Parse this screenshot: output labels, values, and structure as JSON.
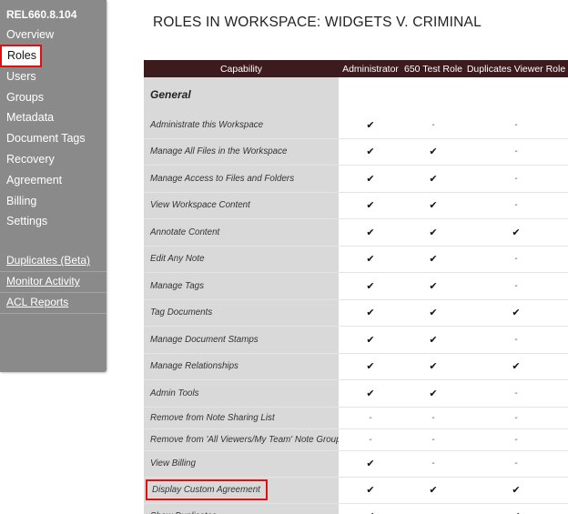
{
  "sidebar": {
    "version": "REL660.8.104",
    "nav": [
      "Overview",
      "Roles",
      "Users",
      "Groups",
      "Metadata",
      "Document Tags",
      "Recovery",
      "Agreement",
      "Billing",
      "Settings"
    ],
    "links": [
      "Duplicates (Beta)",
      "Monitor Activity",
      "ACL Reports"
    ]
  },
  "page": {
    "title": "ROLES IN WORKSPACE: WIDGETS V. CRIMINAL"
  },
  "table": {
    "headers": [
      "Capability",
      "Administrator",
      "650 Test Role",
      "Duplicates Viewer Role"
    ],
    "section": "General",
    "check_symbol": "✔",
    "dash_symbol": "-",
    "rows": [
      {
        "label": "Administrate this Workspace",
        "v": [
          "✔",
          "-",
          "-"
        ]
      },
      {
        "label": "Manage All Files in the Workspace",
        "v": [
          "✔",
          "✔",
          "-"
        ]
      },
      {
        "label": "Manage Access to Files and Folders",
        "v": [
          "✔",
          "✔",
          "-"
        ]
      },
      {
        "label": "View Workspace Content",
        "v": [
          "✔",
          "✔",
          "-"
        ]
      },
      {
        "label": "Annotate Content",
        "v": [
          "✔",
          "✔",
          "✔"
        ]
      },
      {
        "label": "Edit Any Note",
        "v": [
          "✔",
          "✔",
          "-"
        ]
      },
      {
        "label": "Manage Tags",
        "v": [
          "✔",
          "✔",
          "-"
        ]
      },
      {
        "label": "Tag Documents",
        "v": [
          "✔",
          "✔",
          "✔"
        ]
      },
      {
        "label": "Manage Document Stamps",
        "v": [
          "✔",
          "✔",
          "-"
        ]
      },
      {
        "label": "Manage Relationships",
        "v": [
          "✔",
          "✔",
          "✔"
        ]
      },
      {
        "label": "Admin Tools",
        "v": [
          "✔",
          "✔",
          "-"
        ]
      },
      {
        "label": "Remove from Note Sharing List",
        "v": [
          "-",
          "-",
          "-"
        ]
      },
      {
        "label": "Remove from 'All Viewers/My Team' Note Group",
        "v": [
          "-",
          "-",
          "-"
        ]
      },
      {
        "label": "View Billing",
        "v": [
          "✔",
          "-",
          "-"
        ]
      },
      {
        "label": "Display Custom Agreement",
        "v": [
          "✔",
          "✔",
          "✔"
        ]
      },
      {
        "label": "Show Duplicates",
        "v": [
          "✔",
          "-",
          "✔"
        ]
      }
    ]
  }
}
